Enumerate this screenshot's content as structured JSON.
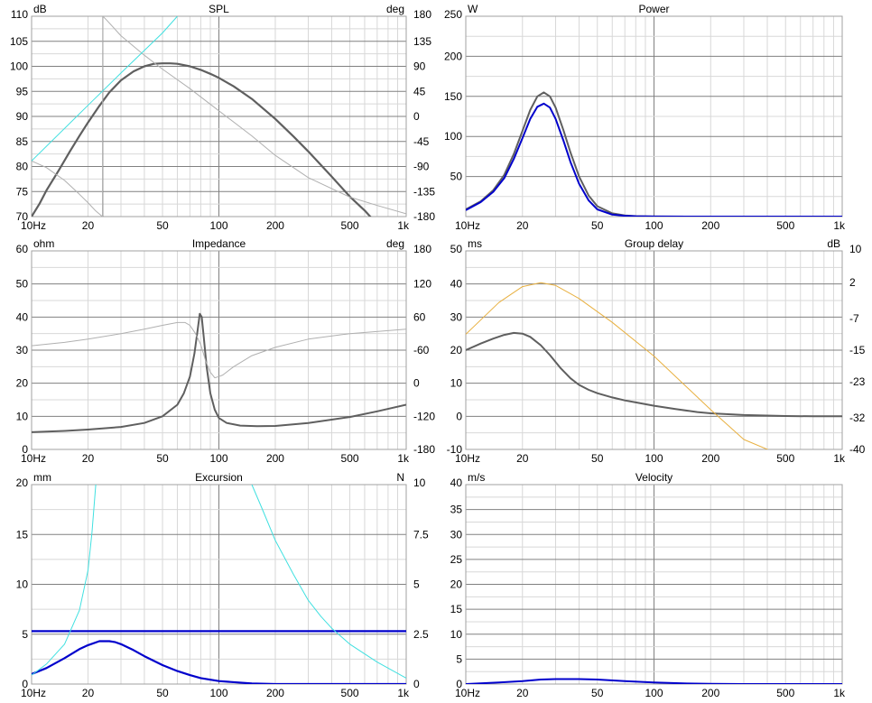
{
  "colors": {
    "gridMajor": "#808080",
    "gridMinor": "#d8d8d8",
    "frame": "#a0a0a0",
    "dark": "#5f5f5f",
    "blue": "#0000cc",
    "lightgray": "#b0b0b0",
    "cyan": "#40e0e0",
    "orange": "#e8b040"
  },
  "chart_data": [
    {
      "type": "line",
      "title": "SPL",
      "xscale": "log",
      "xlim": [
        10,
        1000
      ],
      "xticks": [
        10,
        20,
        50,
        100,
        200,
        500,
        1000
      ],
      "xticklabels": [
        "10Hz",
        "20",
        "50",
        "100",
        "200",
        "500",
        "1k"
      ],
      "ylabel": "dB",
      "ylim": [
        70,
        110
      ],
      "yticks": [
        70,
        75,
        80,
        85,
        90,
        95,
        100,
        105,
        110
      ],
      "yticklabels": [
        "70",
        "75",
        "80",
        "85",
        "90",
        "95",
        "100",
        "105",
        "110"
      ],
      "y2label": "deg",
      "y2lim": [
        -180,
        180
      ],
      "y2ticks": [
        -180,
        -135,
        -90,
        -45,
        0,
        45,
        90,
        135,
        180
      ],
      "y2ticklabels": [
        "-180",
        "-135",
        "-90",
        "-45",
        "0",
        "45",
        "90",
        "135",
        "180"
      ],
      "marker_x": 24,
      "series": [
        {
          "axis": "y",
          "color": "dark",
          "width": 2.2,
          "x": [
            10,
            11,
            12,
            14,
            16,
            18,
            20,
            23,
            26,
            30,
            35,
            40,
            45,
            50,
            55,
            60,
            70,
            80,
            90,
            100,
            120,
            150,
            200,
            250,
            300,
            400,
            500,
            600,
            650
          ],
          "y": [
            70,
            72.5,
            75.2,
            79.3,
            83,
            86.1,
            88.8,
            92.1,
            94.8,
            97.2,
            99,
            100,
            100.5,
            100.6,
            100.6,
            100.5,
            100,
            99.3,
            98.5,
            97.7,
            96,
            93.5,
            89.5,
            86,
            83,
            78,
            74,
            71.2,
            69.8
          ]
        },
        {
          "axis": "y2",
          "color": "lightgray",
          "width": 1,
          "x": [
            10,
            12,
            15,
            18,
            20,
            22,
            23.9,
            24,
            25,
            30,
            40,
            50,
            70,
            100,
            150,
            200,
            300,
            500,
            700,
            1000
          ],
          "y": [
            -80,
            -92,
            -115,
            -140,
            -155,
            -170,
            -180,
            180,
            174,
            145,
            110,
            85,
            50,
            10,
            -35,
            -70,
            -110,
            -145,
            -160,
            -175
          ]
        },
        {
          "axis": "y2",
          "color": "cyan",
          "width": 1,
          "x": [
            10,
            20,
            30,
            50,
            60
          ],
          "y": [
            -80,
            20,
            78,
            150,
            180
          ]
        }
      ]
    },
    {
      "type": "line",
      "title": "Power",
      "xscale": "log",
      "xlim": [
        10,
        1000
      ],
      "xticks": [
        10,
        20,
        50,
        100,
        200,
        500,
        1000
      ],
      "xticklabels": [
        "10Hz",
        "20",
        "50",
        "100",
        "200",
        "500",
        "1k"
      ],
      "ylabel": "W",
      "ylim": [
        0,
        250
      ],
      "yticks": [
        0,
        50,
        100,
        150,
        200,
        250
      ],
      "yticklabels": [
        "",
        "50",
        "100",
        "150",
        "200",
        "250"
      ],
      "series": [
        {
          "axis": "y",
          "color": "dark",
          "width": 2,
          "x": [
            10,
            12,
            14,
            16,
            18,
            20,
            22,
            24,
            26,
            28,
            30,
            33,
            36,
            40,
            45,
            50,
            60,
            70,
            80,
            90,
            100,
            150,
            1000
          ],
          "y": [
            9,
            19,
            33,
            52,
            78,
            107,
            133,
            150,
            155,
            150,
            136,
            108,
            80,
            50,
            26,
            13,
            4,
            1.5,
            0.6,
            0.3,
            0.1,
            0,
            0
          ]
        },
        {
          "axis": "y",
          "color": "blue",
          "width": 2,
          "x": [
            10,
            12,
            14,
            16,
            18,
            20,
            22,
            24,
            26,
            28,
            30,
            33,
            36,
            40,
            45,
            50,
            60,
            70,
            80,
            90,
            100,
            150,
            1000
          ],
          "y": [
            8,
            18,
            31,
            48,
            72,
            98,
            122,
            137,
            141,
            136,
            122,
            95,
            68,
            41,
            20,
            9,
            2.5,
            1,
            0.4,
            0.2,
            0.1,
            0,
            0
          ]
        }
      ]
    },
    {
      "type": "line",
      "title": "Impedance",
      "xscale": "log",
      "xlim": [
        10,
        1000
      ],
      "xticks": [
        10,
        20,
        50,
        100,
        200,
        500,
        1000
      ],
      "xticklabels": [
        "10Hz",
        "20",
        "50",
        "100",
        "200",
        "500",
        "1k"
      ],
      "ylabel": "ohm",
      "ylim": [
        0,
        60
      ],
      "yticks": [
        0,
        10,
        20,
        30,
        40,
        50,
        60
      ],
      "yticklabels": [
        "0",
        "10",
        "20",
        "30",
        "40",
        "50",
        "60"
      ],
      "y2label": "deg",
      "y2lim": [
        -180,
        180
      ],
      "y2ticks": [
        -180,
        -120,
        -60,
        0,
        60,
        120,
        180
      ],
      "y2ticklabels": [
        "-180",
        "-120",
        "0",
        "-60",
        "60",
        "120",
        "180"
      ],
      "series": [
        {
          "axis": "y",
          "color": "dark",
          "width": 2,
          "x": [
            10,
            15,
            20,
            30,
            40,
            50,
            60,
            65,
            70,
            74,
            77,
            79,
            81,
            83,
            86,
            90,
            95,
            100,
            110,
            130,
            160,
            200,
            300,
            500,
            700,
            1000
          ],
          "y": [
            5.2,
            5.6,
            6,
            6.8,
            8,
            10,
            13.5,
            17,
            22,
            29,
            36,
            41,
            40,
            34,
            25,
            17,
            12,
            9.5,
            8,
            7.2,
            7,
            7.1,
            8,
            9.8,
            11.5,
            13.5
          ]
        },
        {
          "axis": "y2",
          "color": "lightgray",
          "width": 1,
          "x": [
            10,
            15,
            20,
            30,
            40,
            50,
            60,
            66,
            70,
            75,
            80,
            85,
            90,
            95,
            100,
            105,
            120,
            150,
            200,
            300,
            500,
            1000
          ],
          "y": [
            8,
            14,
            20,
            30,
            38,
            45,
            50,
            50,
            45,
            30,
            10,
            -20,
            -40,
            -50,
            -48,
            -45,
            -30,
            -10,
            5,
            20,
            30,
            38
          ]
        }
      ]
    },
    {
      "type": "line",
      "title": "Group delay",
      "xscale": "log",
      "xlim": [
        10,
        1000
      ],
      "xticks": [
        10,
        20,
        50,
        100,
        200,
        500,
        1000
      ],
      "xticklabels": [
        "10Hz",
        "20",
        "50",
        "100",
        "200",
        "500",
        "1k"
      ],
      "ylabel": "ms",
      "ylim": [
        -10,
        50
      ],
      "yticks": [
        -10,
        0,
        10,
        20,
        30,
        40,
        50
      ],
      "yticklabels": [
        "-10",
        "0",
        "10",
        "20",
        "30",
        "40",
        "50"
      ],
      "y2label": "dB",
      "y2lim": [
        -40,
        10
      ],
      "y2ticks": [
        -40,
        -32,
        -23,
        -15,
        -7,
        2,
        10
      ],
      "y2ticklabels": [
        "-40",
        "-32",
        "-23",
        "-15",
        "-7",
        "2",
        "10"
      ],
      "series": [
        {
          "axis": "y",
          "color": "dark",
          "width": 2,
          "x": [
            10,
            12,
            14,
            16,
            18,
            20,
            22,
            25,
            28,
            32,
            36,
            40,
            45,
            50,
            60,
            70,
            80,
            100,
            130,
            170,
            200,
            300,
            500,
            700,
            1000
          ],
          "y": [
            20,
            22,
            23.5,
            24.6,
            25.2,
            25,
            24,
            21.5,
            18.5,
            14.5,
            11.5,
            9.5,
            8,
            7,
            5.7,
            4.8,
            4.2,
            3.2,
            2.2,
            1.3,
            0.9,
            0.4,
            0.1,
            0,
            0
          ]
        },
        {
          "axis": "y2",
          "color": "orange",
          "width": 1,
          "x": [
            10,
            15,
            20,
            25,
            30,
            40,
            60,
            100,
            200,
            300,
            450
          ],
          "y": [
            -11,
            -3,
            1,
            2,
            1.3,
            -2,
            -8,
            -16.5,
            -30,
            -37.5,
            -41
          ]
        }
      ]
    },
    {
      "type": "line",
      "title": "Excursion",
      "xscale": "log",
      "xlim": [
        10,
        1000
      ],
      "xticks": [
        10,
        20,
        50,
        100,
        200,
        500,
        1000
      ],
      "xticklabels": [
        "10Hz",
        "20",
        "50",
        "100",
        "200",
        "500",
        "1k"
      ],
      "ylabel": "mm",
      "ylim": [
        0,
        20
      ],
      "yticks": [
        0,
        5,
        10,
        15,
        20
      ],
      "yticklabels": [
        "0",
        "5",
        "10",
        "15",
        "20"
      ],
      "y2label": "N",
      "y2lim": [
        0,
        10
      ],
      "y2ticks": [
        0,
        2.5,
        5,
        7.5,
        10
      ],
      "y2ticklabels": [
        "0",
        "2.5",
        "5",
        "7.5",
        "10"
      ],
      "series": [
        {
          "axis": "y",
          "color": "blue",
          "width": 2.2,
          "x": [
            10,
            12,
            15,
            18,
            20,
            23,
            26,
            28,
            30,
            35,
            40,
            50,
            60,
            70,
            80,
            100,
            150,
            200,
            1000
          ],
          "y": [
            1,
            1.6,
            2.6,
            3.5,
            3.9,
            4.3,
            4.3,
            4.2,
            4,
            3.4,
            2.8,
            1.9,
            1.3,
            0.9,
            0.6,
            0.3,
            0.05,
            0,
            0
          ]
        },
        {
          "axis": "y",
          "color": "blue",
          "width": 2.2,
          "x": [
            10,
            1000
          ],
          "y": [
            5.3,
            5.3
          ]
        },
        {
          "axis": "y2",
          "color": "cyan",
          "width": 1,
          "x": [
            10,
            12,
            15,
            18,
            20,
            21,
            22
          ],
          "y": [
            0.45,
            1,
            2,
            3.7,
            5.7,
            7.6,
            10
          ]
        },
        {
          "axis": "y2",
          "color": "cyan",
          "width": 1,
          "x": [
            150,
            170,
            200,
            250,
            300,
            350,
            400,
            500,
            700,
            1000
          ],
          "y": [
            10,
            8.8,
            7.2,
            5.5,
            4.2,
            3.4,
            2.8,
            2,
            1.1,
            0.3
          ]
        }
      ]
    },
    {
      "type": "line",
      "title": "Velocity",
      "xscale": "log",
      "xlim": [
        10,
        1000
      ],
      "xticks": [
        10,
        20,
        50,
        100,
        200,
        500,
        1000
      ],
      "xticklabels": [
        "10Hz",
        "20",
        "50",
        "100",
        "200",
        "500",
        "1k"
      ],
      "ylabel": "m/s",
      "ylim": [
        0,
        40
      ],
      "yticks": [
        0,
        5,
        10,
        15,
        20,
        25,
        30,
        35,
        40
      ],
      "yticklabels": [
        "0",
        "5",
        "10",
        "15",
        "20",
        "25",
        "30",
        "35",
        "40"
      ],
      "series": [
        {
          "axis": "y",
          "color": "blue",
          "width": 2,
          "x": [
            10,
            15,
            20,
            25,
            30,
            40,
            50,
            70,
            100,
            150,
            200,
            300,
            1000
          ],
          "y": [
            0,
            0.3,
            0.6,
            0.9,
            1,
            1,
            0.9,
            0.6,
            0.3,
            0.1,
            0.05,
            0,
            0
          ]
        }
      ]
    }
  ]
}
